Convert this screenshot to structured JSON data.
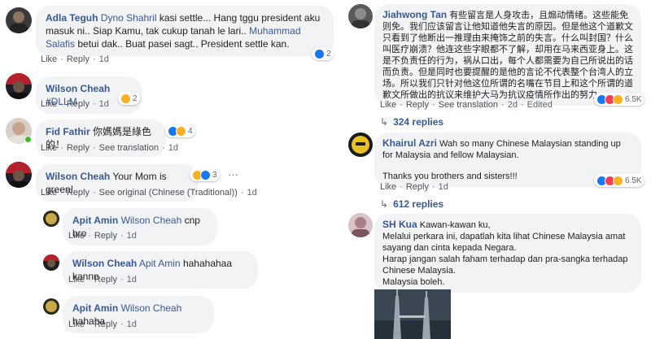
{
  "colors": {
    "link": "#385898",
    "bubble": "#f2f3f5",
    "like": "#1877f2",
    "haha": "#f7b125",
    "love": "#f33e58"
  },
  "left_comments": [
    {
      "author": "Adla Teguh",
      "text_a": " ",
      "mention1": "Dyno Shahril",
      "text_b": " kasi settle... Hang tggu president aku masuk ni.. Siap Kamu, tak cukup tanah le lari..",
      "mention2": "Muhammad Salafis",
      "text_c": " betui dak.. Buat pasei sagt.. President settle kan.",
      "like": "Like",
      "reply": "Reply",
      "time": "1d",
      "reaction_count": "2"
    },
    {
      "author": "Wilson Cheah",
      "mention": "#DLLM",
      "like": "Like",
      "reply": "Reply",
      "time": "1d",
      "reaction_count": "2"
    },
    {
      "author": "Fid Fathir",
      "text": "你媽媽是綠色的！",
      "like": "Like",
      "reply": "Reply",
      "see_translation": "See translation",
      "time": "1d",
      "reaction_count": "4"
    },
    {
      "author": "Wilson Cheah",
      "text": "Your Mom is green!",
      "like": "Like",
      "reply": "Reply",
      "see_original": "See original (Chinese (Traditional))",
      "time": "1d",
      "reaction_count": "3",
      "more": "···"
    },
    {
      "author": "Apit Amin",
      "mention": "Wilson Cheah",
      "text": " cnp bro",
      "like": "Like",
      "reply": "Reply",
      "time": "1d"
    },
    {
      "author": "Wilson Cheah",
      "mention": "Apit Amin",
      "text": " hahahahaa kannn",
      "like": "Like",
      "reply": "Reply",
      "time": "1d"
    },
    {
      "author": "Apit Amin",
      "mention": "Wilson Cheah",
      "text": " hahaha",
      "like": "Like",
      "reply": "Reply",
      "time": "1d"
    }
  ],
  "right_comments": [
    {
      "author": "Jiahwong Tan",
      "text": "有些留言是人身攻击，且煽动情绪。这些能免则免。我们应该留言让他知道他失言的原因。但是他这个道歉文只看到了他断出一推理由来掩饰之前的失言。什么叫封国？什么叫医疗崩溃？他连这些字眼都不了解，却用在马来西亚身上。这是不负责任的行为，祸从口出，每个人都需要为自己所说出的话而负责。但是同时也要提醒的是他的言论不代表整个台湾人的立场。所以我们只针对他这位所谓的名嘴在节目上和这个所谓的道歉文所做出的抗议来维护大马为抗议疫情所作出的努力。",
      "like": "Like",
      "reply": "Reply",
      "see_translation": "See translation",
      "time": "2d",
      "edited": "Edited",
      "reaction_count": "6.5K",
      "replies": "324 replies"
    },
    {
      "author": "Khairul Azri",
      "text1": "Wah so many Chinese Malaysian standing up for Malaysia and fellow Malaysian.",
      "text2": "Thanks you brothers and sisters!!!",
      "like": "Like",
      "reply": "Reply",
      "time": "1d",
      "reaction_count": "6.5K",
      "replies": "612 replies"
    },
    {
      "author": "SH Kua",
      "text1": "Kawan-kawan ku,",
      "text2": "Melalui perkara ini, dapatlah kita lihat Chinese Malaysia amat sayang dan cinta kepada Negara.",
      "text3": "Harap jangan salah faham terhadap dan pra-sangka terhadap Chinese Malaysia.",
      "text4": "Malaysia boleh."
    }
  ]
}
